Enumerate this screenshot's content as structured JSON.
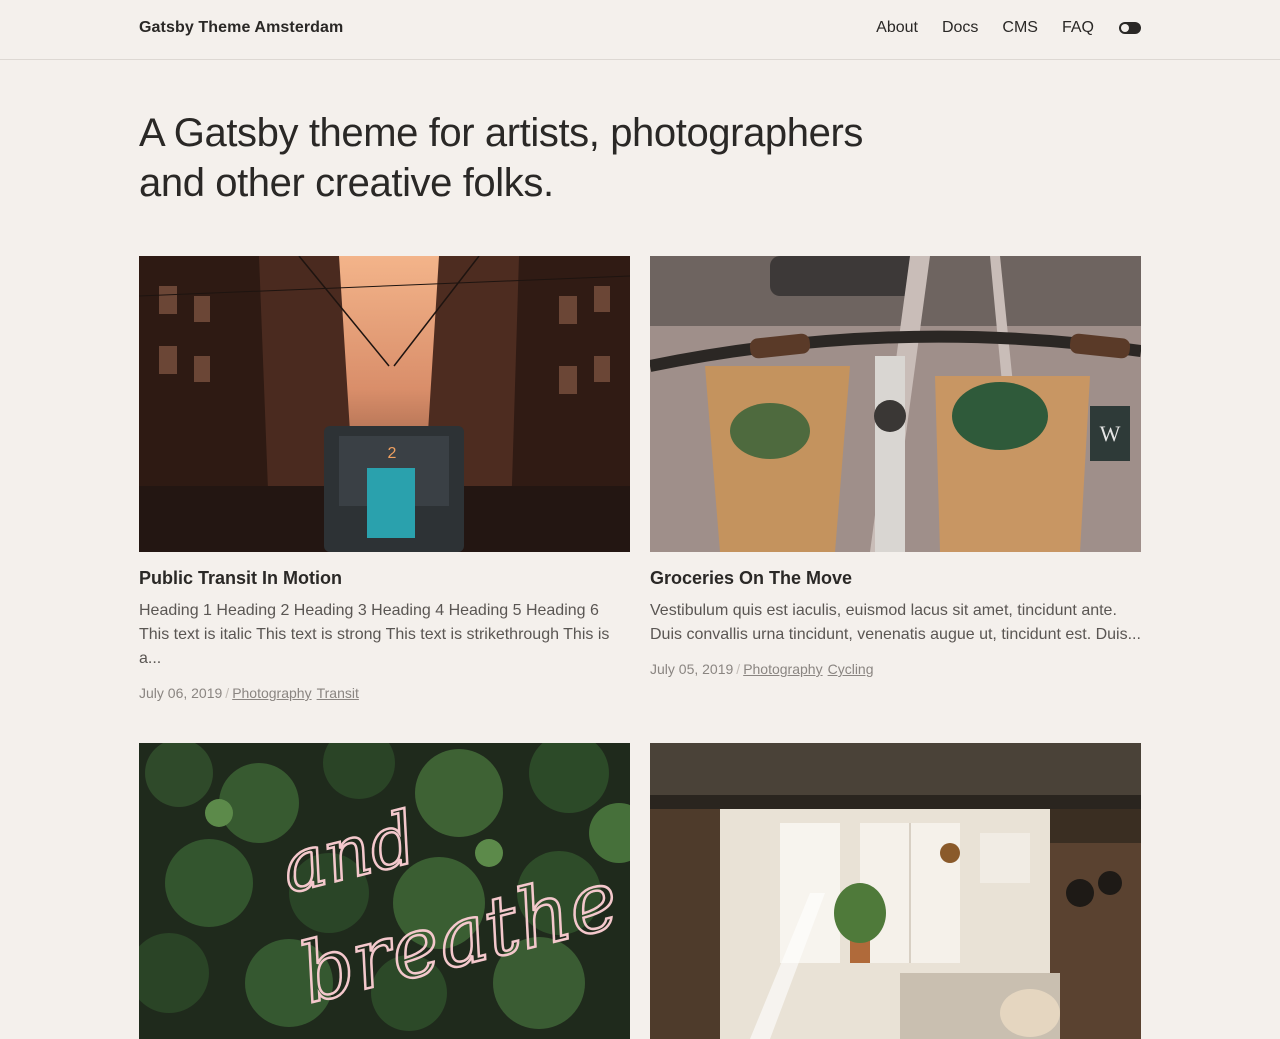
{
  "header": {
    "brand": "Gatsby Theme Amsterdam",
    "nav": [
      {
        "label": "About"
      },
      {
        "label": "Docs"
      },
      {
        "label": "CMS"
      },
      {
        "label": "FAQ"
      }
    ]
  },
  "hero": {
    "title": "A Gatsby theme for artists, photographers and other creative folks."
  },
  "posts": [
    {
      "title": "Public Transit In Motion",
      "excerpt": "Heading 1 Heading 2 Heading 3 Heading 4 Heading 5 Heading 6 This text is italic This text is strong This text is strikethrough This is a...",
      "date": "July 06, 2019",
      "tags": [
        "Photography",
        "Transit"
      ]
    },
    {
      "title": "Groceries On The Move",
      "excerpt": "Vestibulum quis est iaculis, euismod lacus sit amet, tincidunt ante. Duis convallis urna tincidunt, venenatis augue ut, tincidunt est. Duis...",
      "date": "July 05, 2019",
      "tags": [
        "Photography",
        "Cycling"
      ]
    },
    {
      "image_text": [
        "and",
        "breathe"
      ]
    },
    {}
  ],
  "meta": {
    "separator": "/"
  },
  "colors": {
    "background": "#f4f0ec",
    "text": "#2a2826",
    "muted": "#8a8581"
  }
}
